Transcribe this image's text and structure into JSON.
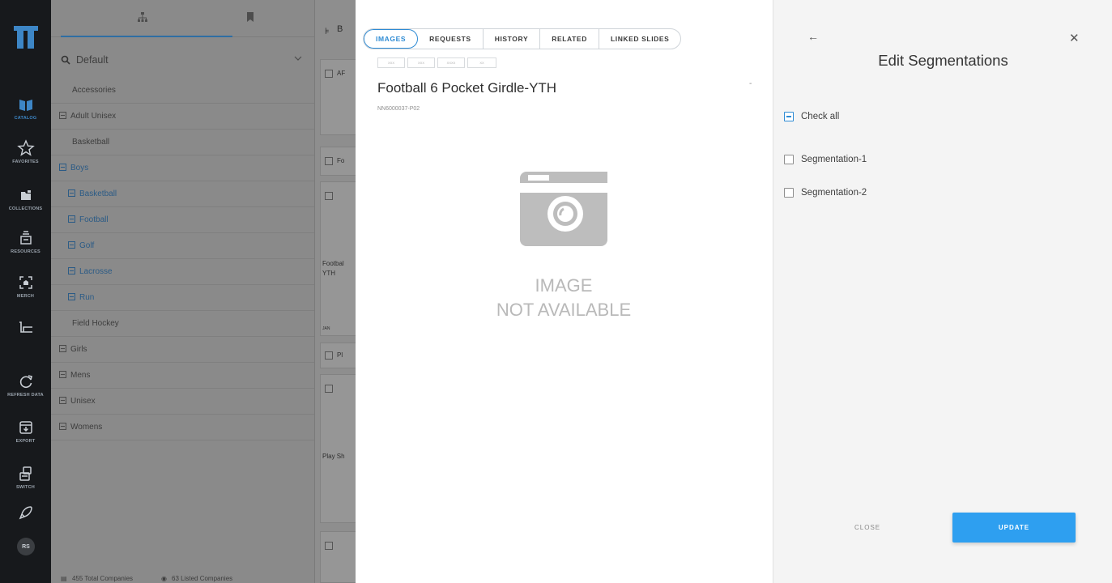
{
  "rail": {
    "items": [
      {
        "label": "CATALOG",
        "icon": "catalog-icon",
        "active": true
      },
      {
        "label": "FAVORITES",
        "icon": "star-icon"
      },
      {
        "label": "COLLECTIONS",
        "icon": "folder-icon"
      },
      {
        "label": "RESOURCES",
        "icon": "resources-icon"
      },
      {
        "label": "MERCH",
        "icon": "merch-icon"
      },
      {
        "label": "",
        "icon": "cart-icon"
      },
      {
        "label": "REFRESH DATA",
        "icon": "refresh-icon"
      },
      {
        "label": "EXPORT",
        "icon": "export-icon"
      },
      {
        "label": "SWITCH",
        "icon": "switch-icon"
      },
      {
        "label": "",
        "icon": "rocket-icon"
      }
    ],
    "avatar": "RS"
  },
  "tree": {
    "search_label": "Default",
    "items": [
      {
        "label": "Accessories"
      },
      {
        "label": "Adult Unisex"
      },
      {
        "label": "Basketball"
      },
      {
        "label": "Boys"
      },
      {
        "label": "Basketball"
      },
      {
        "label": "Football"
      },
      {
        "label": "Golf"
      },
      {
        "label": "Lacrosse"
      },
      {
        "label": "Run"
      },
      {
        "label": "Field Hockey"
      },
      {
        "label": "Girls"
      },
      {
        "label": "Mens"
      },
      {
        "label": "Unisex"
      },
      {
        "label": "Womens"
      }
    ],
    "footer": {
      "total": "455 Total Companies",
      "listed": "63 Listed Companies"
    }
  },
  "strip": {
    "header_letter": "B",
    "cards": [
      {
        "label": "AF"
      },
      {
        "label": "Fo"
      },
      {
        "label": ""
      },
      {
        "label": "Pl"
      },
      {
        "label": ""
      },
      {
        "label": ""
      }
    ],
    "texts": {
      "football": "Footbal",
      "yth": "YTH",
      "play": "Play Sh",
      "jan": "JAN"
    }
  },
  "detail": {
    "tabs": [
      {
        "label": "IMAGES",
        "active": true
      },
      {
        "label": "REQUESTS"
      },
      {
        "label": "HISTORY"
      },
      {
        "label": "RELATED"
      },
      {
        "label": "LINKED SLIDES"
      }
    ],
    "thumbs": [
      "XXX",
      "XXX",
      "XXXX",
      "XX"
    ],
    "title": "Football 6 Pocket Girdle-YTH",
    "dash": "-",
    "sku": "NN6000037-P02",
    "no_image": {
      "line1": "IMAGE",
      "line2": "NOT AVAILABLE"
    }
  },
  "segmentations": {
    "title": "Edit Segmentations",
    "check_all": "Check all",
    "options": [
      {
        "label": "Segmentation-1",
        "checked": false
      },
      {
        "label": "Segmentation-2",
        "checked": false
      }
    ],
    "close_label": "CLOSE",
    "update_label": "UPDATE"
  },
  "colors": {
    "accent": "#2e8bd4",
    "update_button": "#2e9ff0",
    "rail_bg": "#17191c"
  }
}
